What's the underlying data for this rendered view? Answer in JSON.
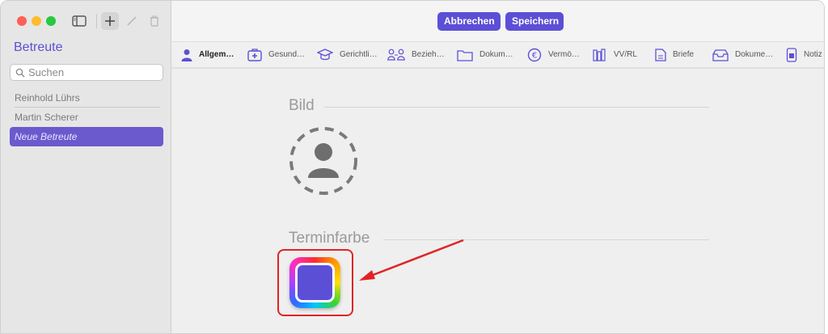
{
  "sidebar": {
    "title": "Betreute",
    "search_placeholder": "Suchen",
    "items": [
      {
        "label": "Reinhold Lührs"
      },
      {
        "label": "Martin Scherer"
      },
      {
        "label": "Neue Betreute"
      }
    ]
  },
  "toolbar": {
    "cancel_label": "Abbrechen",
    "save_label": "Speichern"
  },
  "tabs": [
    {
      "label": "Allgem…",
      "icon": "person-icon"
    },
    {
      "label": "Gesund…",
      "icon": "medical-kit-icon"
    },
    {
      "label": "Gerichtli…",
      "icon": "graduation-cap-icon"
    },
    {
      "label": "Bezieh…",
      "icon": "people-icon"
    },
    {
      "label": "Dokum…",
      "icon": "folder-icon"
    },
    {
      "label": "Vermö…",
      "icon": "euro-icon"
    },
    {
      "label": "VV/RL",
      "icon": "books-icon"
    },
    {
      "label": "Briefe",
      "icon": "document-icon"
    },
    {
      "label": "Dokume…",
      "icon": "tray-icon"
    },
    {
      "label": "Notiz",
      "icon": "note-icon"
    }
  ],
  "sections": {
    "image_title": "Bild",
    "color_title": "Terminfarbe"
  },
  "colors": {
    "accent": "#5b4fd6",
    "selection": "#6a5acd",
    "annotation": "#e02424"
  }
}
